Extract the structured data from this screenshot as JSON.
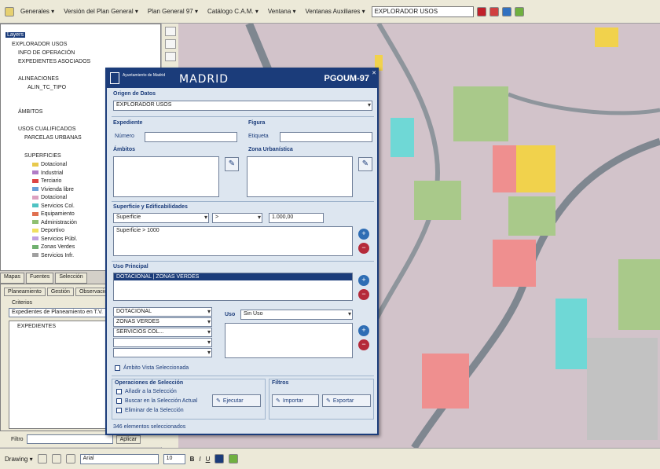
{
  "toolbar": {
    "items": [
      "Generales ▾",
      "Versión del Plan General ▾",
      "Plan General 97 ▾",
      "Catálogo C.A.M. ▾",
      "Ventana ▾",
      "Ventanas Auxiliares ▾"
    ],
    "combo_value": "EXPLORADOR USOS"
  },
  "toc": {
    "root": "Layers",
    "items": [
      "EXPLORADOR USOS",
      "INFO DE OPERACIÓN",
      "EXPEDIENTES ASOCIADOS",
      "ALINEACIONES",
      "ALIN_TC_TIPO",
      "ÁMBITOS",
      "USOS CUALIFICADOS",
      "PARCELAS URBANAS",
      "SUPERFICIES"
    ],
    "legend": [
      "Dotacional",
      "Industrial",
      "Terciario",
      "Vivienda libre",
      "Dotacional",
      "Servicios Col.",
      "Equipamiento",
      "Administración",
      "Deportivo",
      "Servicios Públ.",
      "Zonas Verdes",
      "Servicios Infr."
    ]
  },
  "colors": {
    "legend": [
      "#e8c94c",
      "#b07cc6",
      "#d44",
      "#6aa0d8",
      "#dca0c0",
      "#4fc3c3",
      "#e07050",
      "#8fc070",
      "#f0e060",
      "#c0a0e0",
      "#70b070",
      "#a0a0a0"
    ],
    "accent": "#1b3c7a"
  },
  "tabs": [
    "Mapas",
    "Fuentes",
    "Selección"
  ],
  "lower": {
    "tabs": [
      "Planeamiento",
      "Gestión",
      "Observaciones"
    ],
    "criteria_label": "Criterios",
    "criteria_value": "Expedientes de Planeamiento en T.V.",
    "list_item": "EXPEDIENTES"
  },
  "filter": {
    "label": "Filtro",
    "button": "Aplicar"
  },
  "dialog": {
    "brand_small": "Ayuntamiento\nde Madrid",
    "brand": "MADRID",
    "title": "PGOUM-97",
    "origen_label": "Origen de Datos",
    "origen_value": "EXPLORADOR USOS",
    "expediente_label": "Expediente",
    "numero_label": "Número",
    "figura_label": "Figura",
    "etiqueta_label": "Etiqueta",
    "ambitos_label": "Ámbitos",
    "zona_label": "Zona Urbanística",
    "superficies_label": "Superficie y Edificabilidades",
    "sup_combo1": "Superficie",
    "sup_combo2": ">",
    "sup_value": "1.000,00",
    "sup_expr": "Superficie > 1000",
    "uso_label": "Uso Principal",
    "uso_selected": "DOTACIONAL | ZONAS VERDES",
    "uso_options": [
      "DOTACIONAL",
      "ZONAS VERDES",
      "SERVICIOS COL...",
      "",
      ""
    ],
    "uso_right_label": "Uso",
    "uso_right_value": "Sin Uso",
    "chk_ambito": "Ámbito Vista Seleccionada",
    "ops_label": "Operaciones de Selección",
    "ops": [
      "Añadir a la Selección",
      "Buscar en la Selección Actual",
      "Eliminar de la Selección"
    ],
    "ejecutar": "Ejecutar",
    "filtros_label": "Filtros",
    "importar": "Importar",
    "exportar": "Exportar",
    "status": "346 elementos seleccionados"
  },
  "bottom": {
    "drawing": "Drawing ▾",
    "font": "Arial",
    "size": "10"
  }
}
